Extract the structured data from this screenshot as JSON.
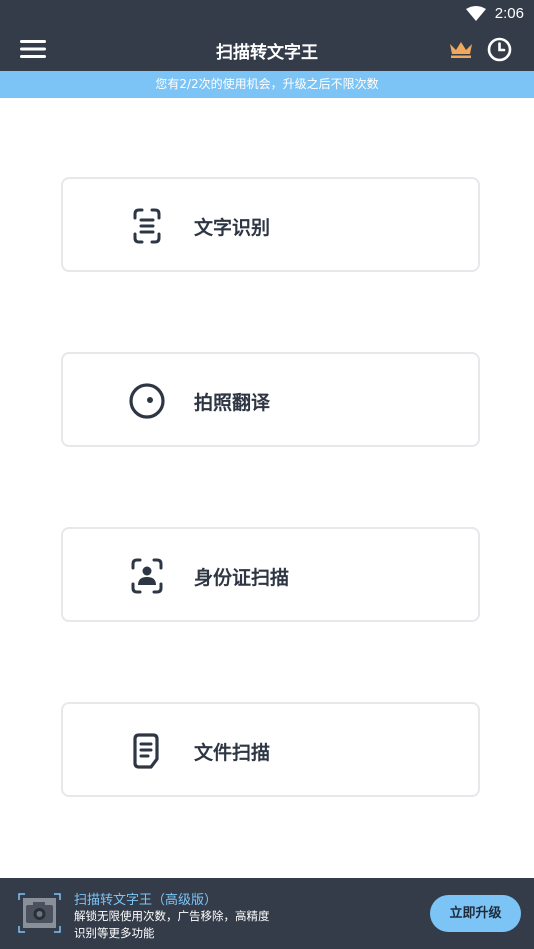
{
  "status_bar": {
    "time": "2:06"
  },
  "app_bar": {
    "title": "扫描转文字王"
  },
  "notice": {
    "text": "您有2/2次的使用机会，升级之后不限次数"
  },
  "features": [
    {
      "label": "文字识别",
      "icon": "text-scan-icon"
    },
    {
      "label": "拍照翻译",
      "icon": "camera-lens-icon"
    },
    {
      "label": "身份证扫描",
      "icon": "id-person-scan-icon"
    },
    {
      "label": "文件扫描",
      "icon": "document-icon"
    }
  ],
  "promo": {
    "title": "扫描转文字王（高级版）",
    "desc_line1": "解锁无限使用次数，广告移除，高精度",
    "desc_line2": "识别等更多功能",
    "button": "立即升级"
  },
  "colors": {
    "dark": "#343c4a",
    "accent": "#7cc4f6",
    "crown": "#f2a85a"
  }
}
